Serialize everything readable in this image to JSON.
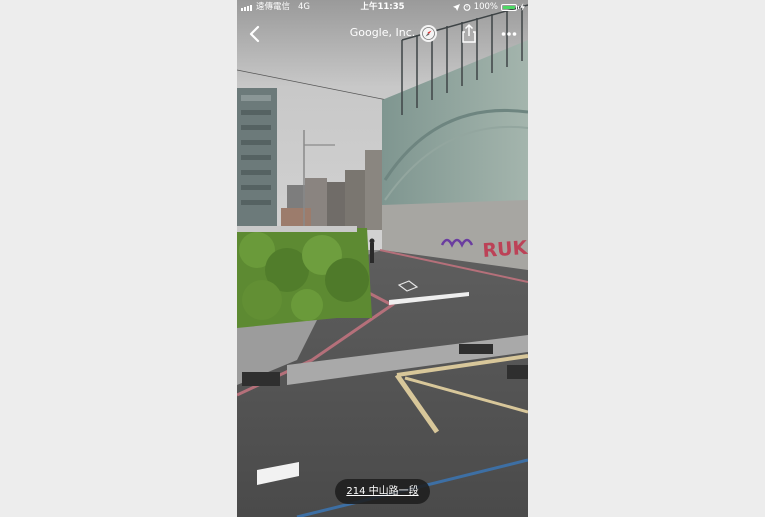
{
  "status_bar": {
    "carrier": "遠傳電信",
    "network": "4G",
    "time": "上午11:35",
    "battery": "100%"
  },
  "nav": {
    "title": "Google, Inc.",
    "back_icon": "chevron-left-icon",
    "compass_icon": "compass-icon",
    "share_icon": "share-icon",
    "more_icon": "ellipsis-icon"
  },
  "street_view": {
    "address": "214 中山路一段",
    "graffiti_text": "RUKI"
  },
  "colors": {
    "sky": "#c9c9c9",
    "road": "#555555",
    "hedge": "#5d8a32",
    "wall": "#8fa39a",
    "curb_red": "#b5707a",
    "road_marking_yellow": "#d8c79a"
  }
}
